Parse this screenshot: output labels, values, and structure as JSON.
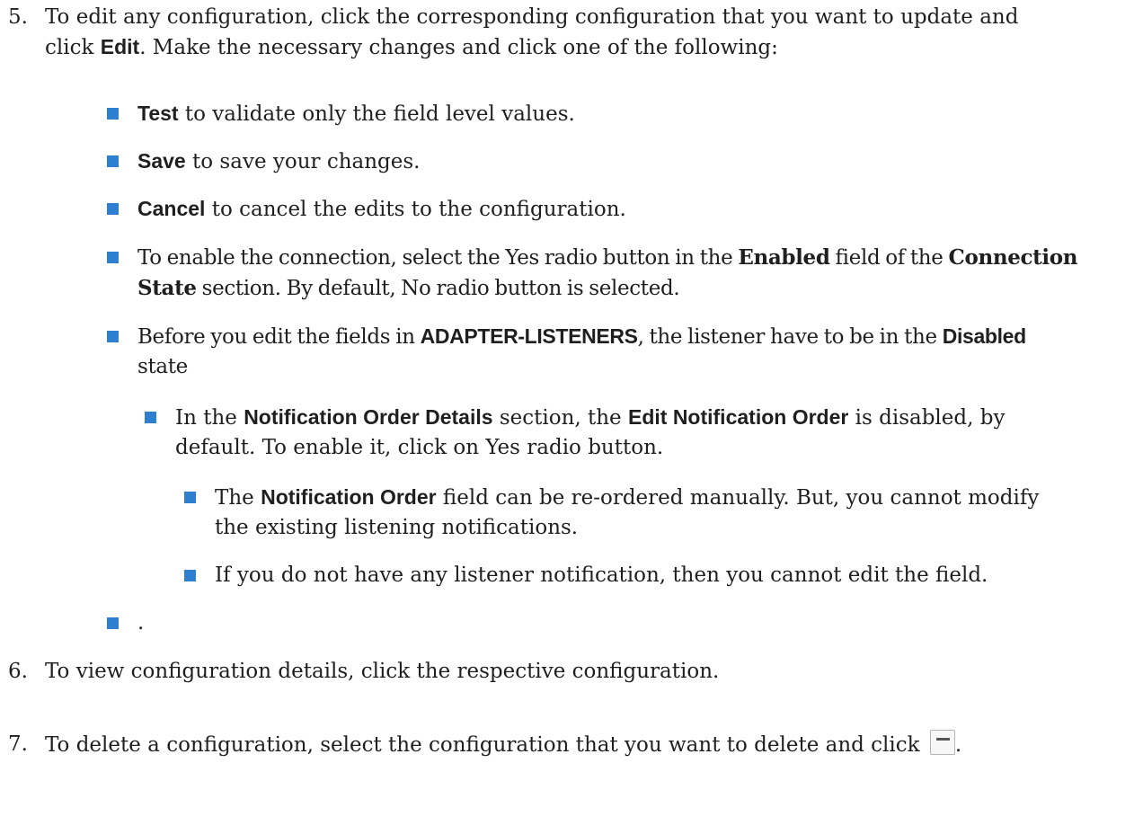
{
  "step5": {
    "number": "5.",
    "intro_line1": "To edit any configuration, click the corresponding configuration that you want to update and",
    "intro_pre": "click ",
    "intro_bold": "Edit",
    "intro_post": ". Make the necessary changes and click one of the following:",
    "bullets": {
      "test": {
        "bold": "Test",
        "text": " to validate only the field level values."
      },
      "save": {
        "bold": "Save",
        "text": " to save your changes."
      },
      "cancel": {
        "bold": "Cancel",
        "text": " to cancel the edits to the configuration."
      },
      "enable": {
        "t1": "To enable the connection, select the Yes radio button in the ",
        "b1": "Enabled",
        "t2": " field of the ",
        "b2": "Connection",
        "b3": "State",
        "t3": " section. By default, No radio button is selected."
      },
      "adapter": {
        "t1": "Before you edit the fields in ",
        "b1": "ADAPTER-LISTENERS",
        "t2": ", the listener have to be in the ",
        "b2": "Disabled",
        "t3": "state"
      },
      "notification_details": {
        "t1": "In the ",
        "b1": "Notification Order Details",
        "t2": " section, the ",
        "b2": "Edit Notification Order",
        "t3": " is disabled, by",
        "t4": "default. To enable it, click on Yes radio button."
      },
      "notification_order": {
        "t1": "The ",
        "b1": "Notification Order",
        "t2": " field can be re-ordered manually. But, you cannot modify",
        "t3": "the existing listening notifications."
      },
      "no_listener": {
        "text": "If you do not have any listener notification, then you cannot edit the field."
      },
      "dot": {
        "text": "."
      }
    }
  },
  "step6": {
    "number": "6.",
    "text": "To view configuration details, click the respective configuration."
  },
  "step7": {
    "number": "7.",
    "text": "To delete a configuration, select the configuration that you want to delete and click ",
    "end": ".",
    "icon": "minus-icon"
  },
  "colors": {
    "bullet": "#2f7fd0",
    "text": "#1f1f1f"
  }
}
